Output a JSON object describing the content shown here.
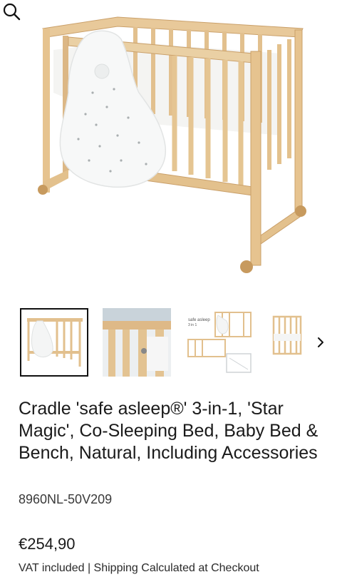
{
  "product": {
    "title": "Cradle 'safe asleep®' 3-in-1, 'Star Magic', Co-Sleeping Bed, Baby Bed & Bench, Natural, Including Accessories",
    "sku": "8960NL-50V209",
    "price": "€254,90",
    "vat_shipping": "VAT included | Shipping Calculated at Checkout"
  },
  "gallery": {
    "zoom_icon": "search-icon",
    "next_icon": "chevron-right-icon",
    "thumb3_caption": "safe asleep\n3 in 1",
    "thumbnails": [
      {
        "name": "thumb-1",
        "active": true
      },
      {
        "name": "thumb-2",
        "active": false
      },
      {
        "name": "thumb-3",
        "active": false
      },
      {
        "name": "thumb-4",
        "active": false
      }
    ]
  },
  "colors": {
    "wood": "#e8c99a",
    "wood_dark": "#caa06a",
    "text": "#1a1a1a"
  }
}
